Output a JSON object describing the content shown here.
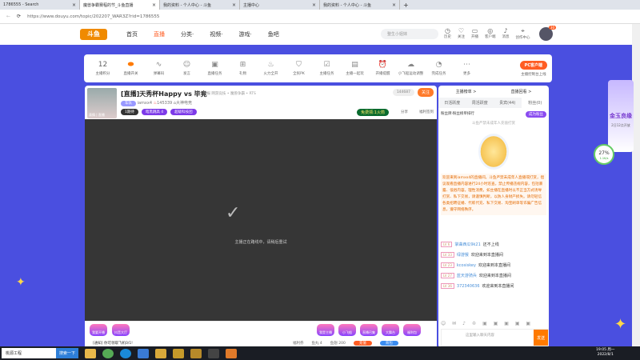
{
  "browser": {
    "tabs": [
      "1786555 - Search",
      "魔兽争霸赛程的节_斗鱼直播",
      "我的资料 - 个人中心 - 斗鱼",
      "主播中心",
      "我的资料 - 个人中心 - 斗鱼"
    ],
    "url": "https://www.douyu.com/topic/202207_WAR3Z?rid=1786555"
  },
  "header": {
    "logo": "斗鱼",
    "nav": [
      "首页",
      "直播",
      "分类·",
      "视频·",
      "游戏·",
      "鱼吧"
    ],
    "search_placeholder": "整生小姐妹",
    "icons": [
      {
        "icon": "clock-icon",
        "label": "历史"
      },
      {
        "icon": "heart-icon",
        "label": "关注"
      },
      {
        "icon": "video-icon",
        "label": "开播"
      },
      {
        "icon": "client-icon",
        "label": "客户端"
      },
      {
        "icon": "bell-icon",
        "label": "消息"
      },
      {
        "icon": "location-icon",
        "label": "创作中心"
      }
    ],
    "avatar_badge": "30"
  },
  "toolbar": {
    "score": "12",
    "score_label": "主播积分",
    "items": [
      "直播开关",
      "弹幕码",
      "发言",
      "直播任务",
      "礼物",
      "火力全开",
      "全民PK",
      "主播任务",
      "主播一起玩",
      "开播提醒",
      "小飞船运动调整",
      "完成任务",
      "更多"
    ],
    "pc_button": "PC客户端",
    "pc_sub": "主播控制台上线"
  },
  "room": {
    "title": "[直播]天秀杯Happy vs 毕竟",
    "sub": "举报  网游竞技 • 魔兽争霸 • RTS",
    "badge": "车队",
    "streamer": "iamxx4",
    "hot": "145339",
    "team": "大神电竞",
    "cover_label": "表情 | 直播",
    "tags": [
      "1期待",
      "暗黑跳高 4",
      "超级科技团"
    ],
    "followers": "144687",
    "follow": "关注",
    "box": "免费领:1火箭",
    "share": "分享",
    "report": "福利签到",
    "video_msg": "主播正在路线中，请稍后重试"
  },
  "gifts": {
    "left": [
      "我要开播",
      "抖音大厅"
    ],
    "right": [
      "我是主播",
      "小飞船",
      "直播召集",
      "大舞台",
      "福利包"
    ],
    "notice": "[通知] 你可领取飞机0/1!",
    "bottom": [
      "福利券",
      "鱼丸 4",
      "鱼翅 200"
    ],
    "recharge": "充值",
    "backpack": "背包"
  },
  "side": {
    "rank": "主播榜单 >",
    "info": "直播回看 >",
    "tabs": [
      "日活跃度",
      "周活跃度",
      "贵宾(44)",
      "粉丝(0)"
    ],
    "fan_title": "粉丝牌·粉丝榜单排行",
    "join": "成为粉丝",
    "empty": "斗鱼严禁未成年人充值打赏",
    "notice": "欢迎来到iamxx4的直播间。斗鱼严禁未成年人直播或打赏，倡议观看直播内容进行24小时巡查。禁止传播违规内容，包括暴露、低俗内容。理性消费，如主播在直播时以不正当方式诱导打赏、私下交易，请谨慎判断，以防人身财产损失。请勿轻信各类招聘征婚、代练代充、私下交易、淘宝刷单等诈骗广告信息，遵守网络秩序。",
    "chat": [
      {
        "lv": "LV 6",
        "name": "掌曲西瓜9k21",
        "msg": "还不上线"
      },
      {
        "lv": "LV 33",
        "name": "绿游猴",
        "msg": "欢迎来到本直播间"
      },
      {
        "lv": "LV 23",
        "name": "kcosiskey",
        "msg": "欢迎来到本直播间"
      },
      {
        "lv": "LV 27",
        "name": "蓝天游骑兵",
        "msg": "欢迎来到本直播间"
      },
      {
        "lv": "LV 36",
        "name": "372340636",
        "msg": "欢迎来到本直播间"
      }
    ],
    "input_placeholder": "这里输入聊天内容",
    "send": "发送"
  },
  "promo": {
    "title": "金玉良缘",
    "date": "2日12点开放",
    "percent": "27%",
    "speed": "1.1K/s"
  },
  "taskbar": {
    "search": "桃源工程",
    "search_btn": "搜索一下",
    "time": "19:05 周一",
    "date": "2022/8/1"
  }
}
